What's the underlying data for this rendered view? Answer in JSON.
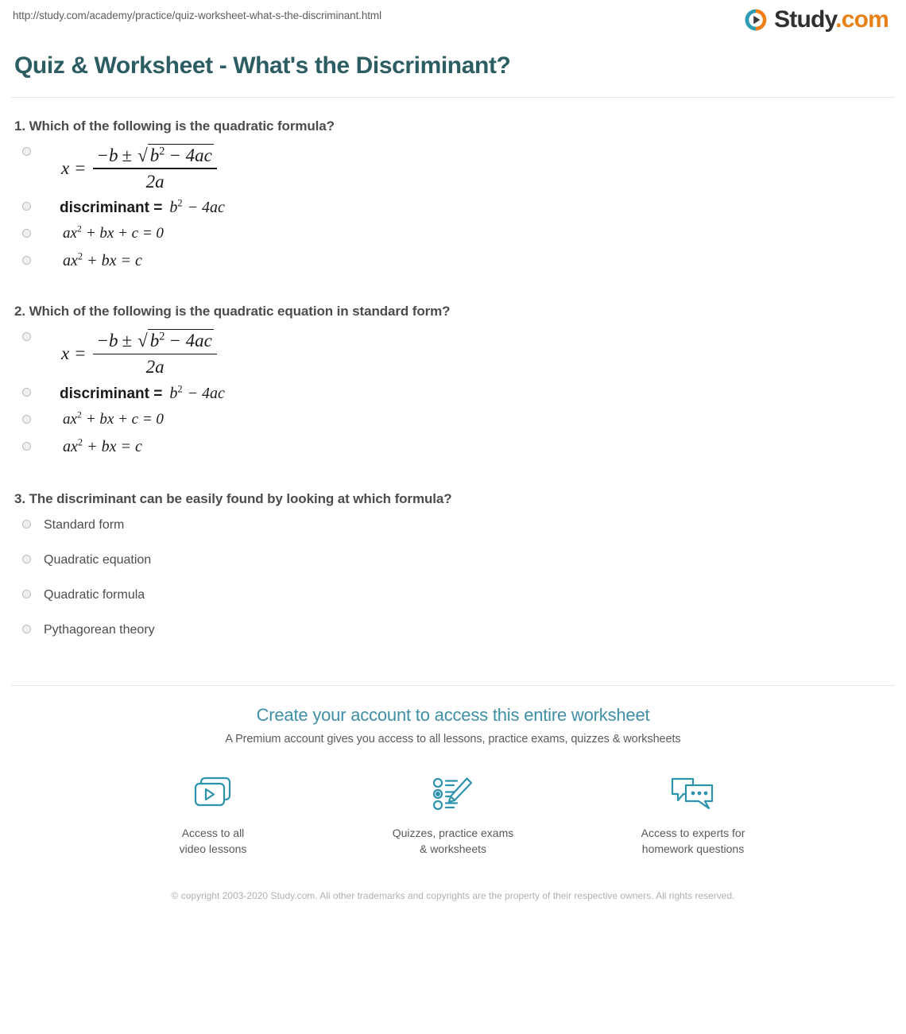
{
  "browser": {
    "url": "http://study.com/academy/practice/quiz-worksheet-what-s-the-discriminant.html"
  },
  "brand": {
    "name": "Study",
    "suffix": ".com",
    "logo_icon": "play-circle-icon",
    "accent_teal": "#2e9bb5",
    "accent_orange": "#e8801a"
  },
  "header": {
    "title": "Quiz & Worksheet - What's the Discriminant?",
    "title_color": "#2c5d63"
  },
  "questions": [
    {
      "number": "1.",
      "prompt": "1. Which of the following is the quadratic formula?",
      "options": [
        {
          "type": "fraction",
          "lhs": "x =",
          "numerator_parts": [
            "−b",
            "±",
            "√",
            "b",
            "2",
            "− 4ac"
          ],
          "denominator": "2a",
          "text": "x = (−b ± √(b² − 4ac)) / 2a"
        },
        {
          "type": "discriminant",
          "label": "discriminant =",
          "expr_base": "b",
          "expr_exp": "2",
          "expr_tail": "− 4ac",
          "text": "discriminant = b² − 4ac"
        },
        {
          "type": "standard",
          "base": "ax",
          "exp": "2",
          "tail": "+ bx + c = 0",
          "text": "ax² + bx + c = 0"
        },
        {
          "type": "standard",
          "base": "ax",
          "exp": "2",
          "tail": "+ bx = c",
          "text": "ax² + bx = c"
        }
      ]
    },
    {
      "number": "2.",
      "prompt": "2. Which of the following is the quadratic equation in standard form?",
      "options": [
        {
          "type": "fraction",
          "lhs": "x =",
          "numerator_parts": [
            "−b",
            "±",
            "√",
            "b",
            "2",
            "− 4ac"
          ],
          "denominator": "2a",
          "text": "x = (−b ± √(b² − 4ac)) / 2a"
        },
        {
          "type": "discriminant",
          "label": "discriminant =",
          "expr_base": "b",
          "expr_exp": "2",
          "expr_tail": "− 4ac",
          "text": "discriminant = b² − 4ac"
        },
        {
          "type": "standard",
          "base": "ax",
          "exp": "2",
          "tail": "+ bx + c = 0",
          "text": "ax² + bx + c = 0"
        },
        {
          "type": "standard",
          "base": "ax",
          "exp": "2",
          "tail": "+ bx = c",
          "text": "ax² + bx = c"
        }
      ]
    },
    {
      "number": "3.",
      "prompt": "3. The discriminant can be easily found by looking at which formula?",
      "options": [
        {
          "type": "plain",
          "text": "Standard form"
        },
        {
          "type": "plain",
          "text": "Quadratic equation"
        },
        {
          "type": "plain",
          "text": "Quadratic formula"
        },
        {
          "type": "plain",
          "text": "Pythagorean theory"
        }
      ]
    }
  ],
  "cta": {
    "title": "Create your account to access this entire worksheet",
    "subtitle": "A Premium account gives you access to all lessons, practice exams, quizzes & worksheets",
    "features": [
      {
        "icon": "video-stack-play-icon",
        "line1": "Access to all",
        "line2": "video lessons"
      },
      {
        "icon": "quiz-checklist-pencil-icon",
        "line1": "Quizzes, practice exams",
        "line2": "& worksheets"
      },
      {
        "icon": "chat-bubbles-icon",
        "line1": "Access to experts for",
        "line2": "homework questions"
      }
    ]
  },
  "footer": {
    "copyright": "© copyright 2003-2020 Study.com. All other trademarks and copyrights are the property of their respective owners. All rights reserved."
  }
}
